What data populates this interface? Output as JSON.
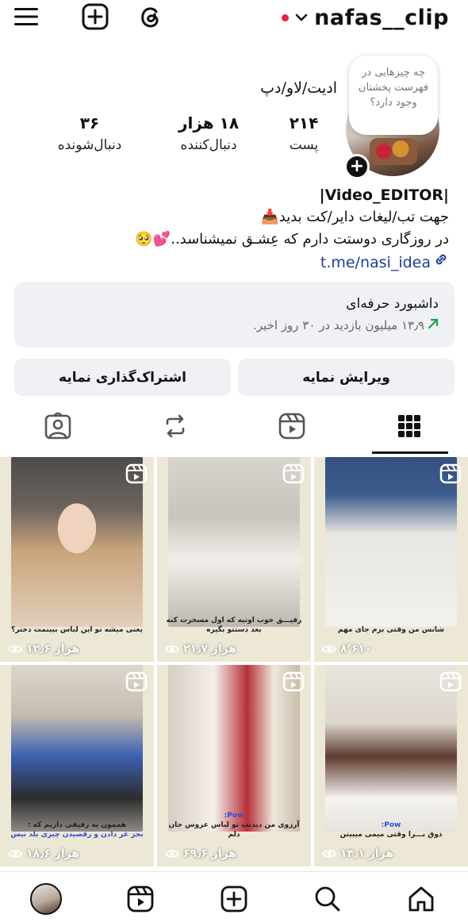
{
  "topbar": {
    "username": "nafas__clip",
    "menu_icon": "hamburger-menu-icon",
    "create_icon": "plus-square-icon",
    "threads_icon": "threads-icon",
    "status_dot_color": "#e8213d"
  },
  "profile": {
    "note": "چه چیزهایی در فهرست پخشتان وجود دارد؟",
    "display_name": "ادیت/لاو/دپ",
    "stats": [
      {
        "value": "۲۱۴",
        "label": "پست"
      },
      {
        "value": "۱۸ هزار",
        "label": "دنبال‌کننده"
      },
      {
        "value": "۳۶",
        "label": "دنبال‌شونده"
      }
    ]
  },
  "bio": {
    "line1": "|Video_EDITOR|",
    "line2": "جهت تب/لیغات دایر/کت بدید📥",
    "line3": "در روزگاری دوستت دارم که عِشـق نمیشناسد..💕🥺",
    "link": "t.me/nasi_idea"
  },
  "dashboard": {
    "title": "داشبورد حرفه‌ای",
    "subtitle": "۱۳٫۹ میلیون بازدید در ۳۰ روز اخیر.",
    "trend_color": "#1aa34a"
  },
  "buttons": {
    "edit": "ویرایش نمایه",
    "share": "اشتراک‌گذاری نمایه"
  },
  "tabs": [
    "grid-tab",
    "reels-tab",
    "reposts-tab",
    "tagged-tab"
  ],
  "grid": [
    {
      "views": "۱۲٫۶ هزار",
      "caption": "یعنی میشه تو این لباس ببینمت دختر؟",
      "caption2": ""
    },
    {
      "views": "۲۱٫۷ هزار",
      "caption": "رفیـــق خوب اونیه که اول مسخرت کنه",
      "caption2": "بعد دستتو بگیره"
    },
    {
      "views": "۸٬۶۱۰",
      "caption": "شانس من وقتی برم جای مهم",
      "caption2": ""
    },
    {
      "views": "۱۸٫۶ هزار",
      "caption": "هممون یه رفیقی داریم که :",
      "caption2": "بجز غر دادن و رقصیدن چیزی بلد نیس"
    },
    {
      "views": "۶۹٫۶ هزار",
      "caption": "Pow:",
      "caption2": "آرزوی من دیدنت تو لباس عروس جان دلم"
    },
    {
      "views": "۱۴٫۱ هزار",
      "caption": "Pow:",
      "caption2": "ذوق بـــرا وقتی میمی میبینن"
    }
  ],
  "bottom_nav": [
    "home-icon",
    "search-icon",
    "create-icon",
    "reels-icon",
    "profile-avatar"
  ]
}
